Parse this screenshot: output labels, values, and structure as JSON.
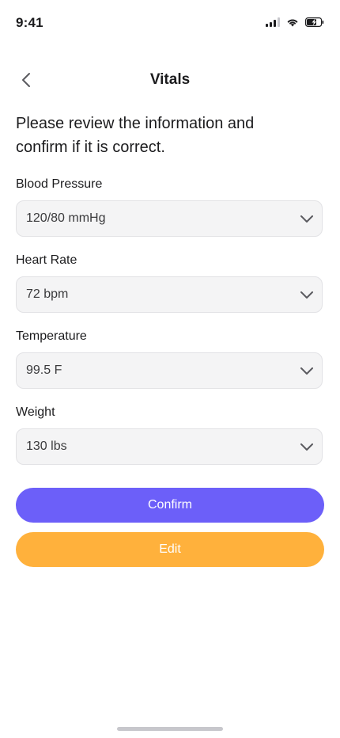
{
  "status_bar": {
    "time": "9:41"
  },
  "header": {
    "title": "Vitals"
  },
  "intro_text": "Please review the information and confirm if it is correct.",
  "fields": [
    {
      "label": "Blood Pressure",
      "value": "120/80 mmHg"
    },
    {
      "label": "Heart Rate",
      "value": "72 bpm"
    },
    {
      "label": "Temperature",
      "value": "99.5 F"
    },
    {
      "label": "Weight",
      "value": "130 lbs"
    }
  ],
  "actions": {
    "confirm_label": "Confirm",
    "edit_label": "Edit"
  },
  "colors": {
    "confirm": "#6C5FF9",
    "edit": "#FFB13C",
    "field_bg": "#F4F4F5"
  }
}
